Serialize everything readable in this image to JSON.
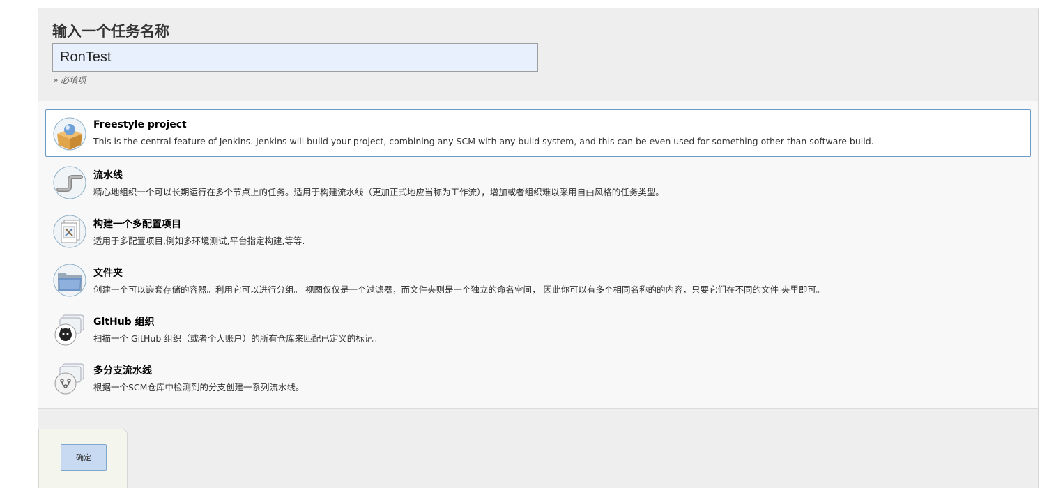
{
  "header": {
    "title": "输入一个任务名称",
    "name_value": "RonTest",
    "required_hint": "» 必填项"
  },
  "items": [
    {
      "title": "Freestyle project",
      "desc": "This is the central feature of Jenkins. Jenkins will build your project, combining any SCM with any build system, and this can be even used for something other than software build.",
      "icon": "freestyle-box-icon",
      "selected": true
    },
    {
      "title": "流水线",
      "desc": "精心地组织一个可以长期运行在多个节点上的任务。适用于构建流水线（更加正式地应当称为工作流），增加或者组织难以采用自由风格的任务类型。",
      "icon": "pipeline-icon",
      "selected": false
    },
    {
      "title": "构建一个多配置项目",
      "desc": "适用于多配置项目,例如多环境测试,平台指定构建,等等.",
      "icon": "multi-config-icon",
      "selected": false
    },
    {
      "title": "文件夹",
      "desc": "创建一个可以嵌套存储的容器。利用它可以进行分组。 视图仅仅是一个过滤器，而文件夹则是一个独立的命名空间， 因此你可以有多个相同名称的的内容，只要它们在不同的文件 夹里即可。",
      "icon": "folder-icon",
      "selected": false
    },
    {
      "title": "GitHub 组织",
      "desc": "扫描一个 GitHub 组织（或者个人账户）的所有仓库来匹配已定义的标记。",
      "icon": "github-organization-icon",
      "selected": false
    },
    {
      "title": "多分支流水线",
      "desc": "根据一个SCM仓库中检测到的分支创建一系列流水线。",
      "icon": "multibranch-pipeline-icon",
      "selected": false
    }
  ],
  "footer": {
    "ok_label": "确定"
  }
}
